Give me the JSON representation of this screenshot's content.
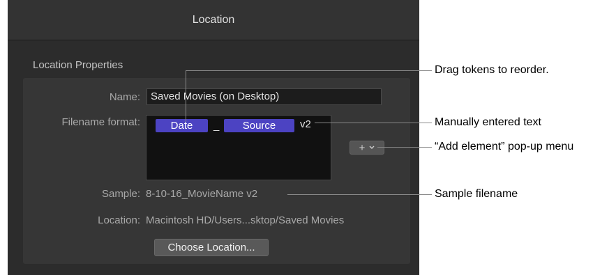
{
  "window": {
    "title": "Location"
  },
  "section": {
    "title": "Location Properties"
  },
  "form": {
    "name_label": "Name:",
    "name_value": "Saved Movies (on Desktop)",
    "filename_format_label": "Filename format:",
    "tokens": [
      "Date",
      "Source"
    ],
    "separator": "_",
    "typed_text": "v2",
    "sample_label": "Sample:",
    "sample_value": "8-10-16_MovieName v2",
    "location_label": "Location:",
    "location_value": "Macintosh HD/Users...sktop/Saved Movies",
    "choose_button": "Choose Location..."
  },
  "add_element": {
    "icon": "plus-icon",
    "chevron": "chevron-down-icon"
  },
  "callouts": {
    "drag": "Drag tokens to reorder.",
    "manual": "Manually entered text",
    "add_menu": "“Add element” pop-up menu",
    "sample": "Sample filename"
  },
  "colors": {
    "token": "#4c43c2",
    "panel": "#2c2c2c"
  }
}
